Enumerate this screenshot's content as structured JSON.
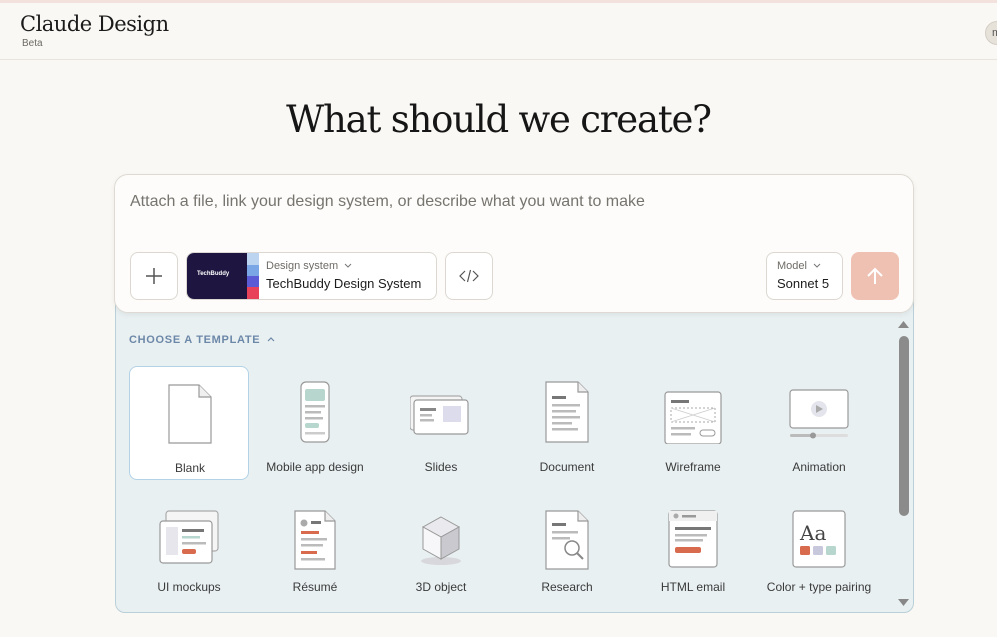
{
  "header": {
    "brand": "Claude Design",
    "badge": "Beta",
    "avatar_initial": "m"
  },
  "headline": "What should we create?",
  "prompt": {
    "placeholder": "Attach a file, link your design system, or describe what you want to make",
    "add_icon": "plus-icon",
    "code_icon": "code-icon",
    "send_icon": "arrow-up-icon",
    "send_color": "#efc1b2"
  },
  "design_system": {
    "caption": "Design system",
    "name": "TechBuddy Design System",
    "thumb_logo": "TechBuddy",
    "thumb_bg": "#1e1640"
  },
  "model": {
    "caption": "Model",
    "name": "Sonnet 5"
  },
  "templates": {
    "section_title": "CHOOSE A TEMPLATE",
    "items": [
      {
        "label": "Blank",
        "icon": "blank-page-icon",
        "selected": true
      },
      {
        "label": "Mobile app design",
        "icon": "mobile-app-icon"
      },
      {
        "label": "Slides",
        "icon": "slides-icon"
      },
      {
        "label": "Document",
        "icon": "document-icon"
      },
      {
        "label": "Wireframe",
        "icon": "wireframe-icon"
      },
      {
        "label": "Animation",
        "icon": "animation-icon"
      },
      {
        "label": "UI mockups",
        "icon": "ui-mockups-icon"
      },
      {
        "label": "Résumé",
        "icon": "resume-icon"
      },
      {
        "label": "3D object",
        "icon": "cube-icon"
      },
      {
        "label": "Research",
        "icon": "research-icon"
      },
      {
        "label": "HTML email",
        "icon": "html-email-icon"
      },
      {
        "label": "Color + type pairing",
        "icon": "color-type-icon",
        "glyph": "Aa"
      }
    ]
  },
  "colors": {
    "accent": "#6c88a8",
    "panel": "#e9f0f2",
    "background": "#faf8f4"
  }
}
